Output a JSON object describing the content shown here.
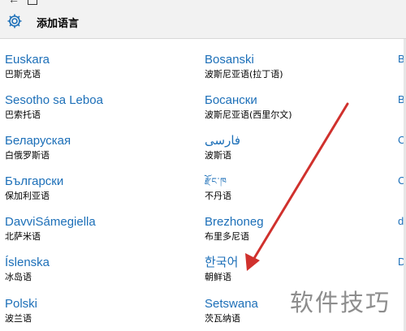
{
  "header": {
    "title": "添加语言",
    "settings_icon": "gear-icon",
    "back_icon": "back-arrow-icon"
  },
  "languages": [
    {
      "native": "Euskara",
      "zh": "巴斯克语"
    },
    {
      "native": "Bosanski",
      "zh": "波斯尼亚语(拉丁语)"
    },
    {
      "native": "Sesotho sa Leboa",
      "zh": "巴索托语"
    },
    {
      "native": "Босански",
      "zh": "波斯尼亚语(西里尔文)"
    },
    {
      "native": "Беларуская",
      "zh": "白俄罗斯语"
    },
    {
      "native": "فارسی",
      "zh": "波斯语"
    },
    {
      "native": "Български",
      "zh": "保加利亚语"
    },
    {
      "native": "རྫོང་ཁ",
      "zh": "不丹语"
    },
    {
      "native": "DavviSámegiella",
      "zh": "北萨米语"
    },
    {
      "native": "Brezhoneg",
      "zh": "布里多尼语"
    },
    {
      "native": "Íslenska",
      "zh": "冰岛语"
    },
    {
      "native": "한국어",
      "zh": "朝鲜语"
    },
    {
      "native": "Polski",
      "zh": "波兰语"
    },
    {
      "native": "Setswana",
      "zh": "茨瓦纳语"
    }
  ],
  "watermark": "软件技巧",
  "colors": {
    "accent": "#1c6fb8",
    "arrow": "#d0312d",
    "header_bg": "#f2f2f2"
  }
}
